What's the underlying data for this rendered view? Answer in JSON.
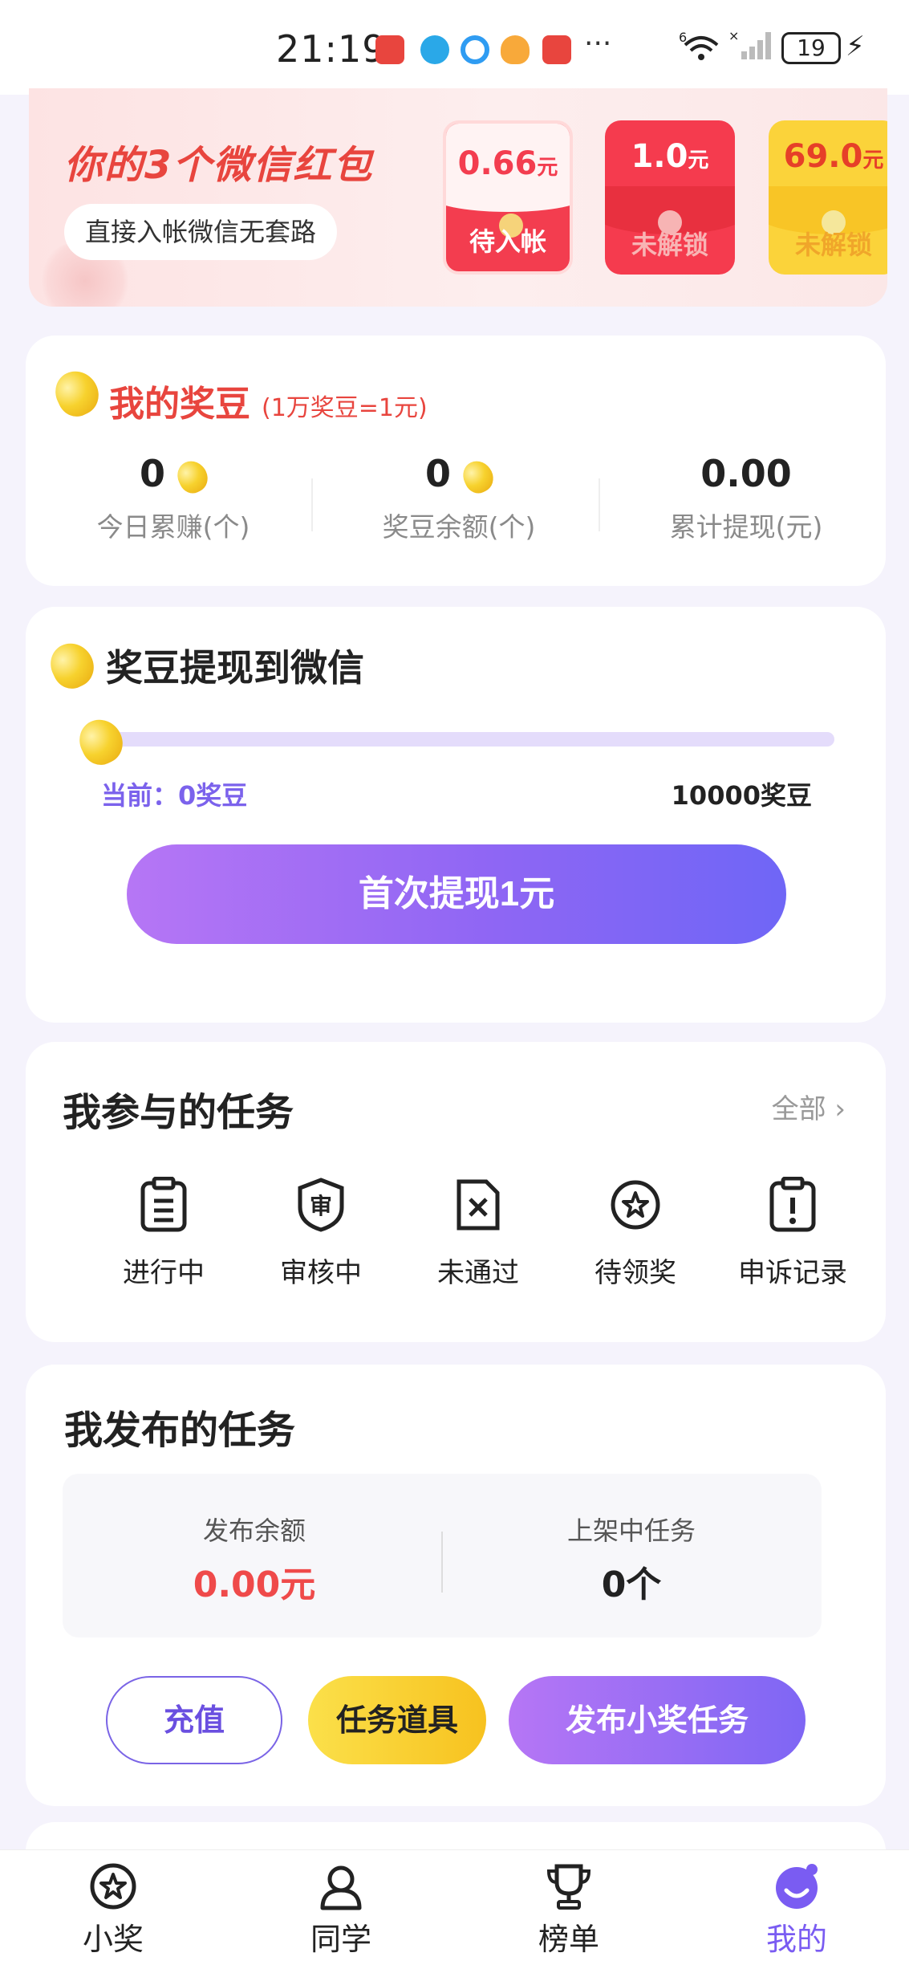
{
  "status_bar": {
    "time": "21:19",
    "more": "···",
    "network": "6",
    "battery": "19",
    "icons": [
      "huawei-store-icon",
      "browser-icon",
      "search-icon",
      "cat-app-icon",
      "huawei-store-icon",
      "wifi-icon",
      "signal-icon",
      "battery-icon",
      "charging-icon"
    ]
  },
  "banner": {
    "title": "你的3个微信红包",
    "subtitle": "直接入帐微信无套路",
    "envelopes": [
      {
        "amount": "0.66",
        "unit": "元",
        "status": "待入帐"
      },
      {
        "amount": "1.0",
        "unit": "元",
        "status": "未解锁"
      },
      {
        "amount": "69.0",
        "unit": "元",
        "status": "未解锁"
      }
    ]
  },
  "beans": {
    "title": "我的奖豆",
    "rate": "(1万奖豆=1元)",
    "stats": [
      {
        "value": "0",
        "label": "今日累赚(个)"
      },
      {
        "value": "0",
        "label": "奖豆余额(个)"
      },
      {
        "value": "0.00",
        "label": "累计提现(元)"
      }
    ]
  },
  "withdraw": {
    "title": "奖豆提现到微信",
    "current": "当前：0奖豆",
    "target": "10000奖豆",
    "progress": 0,
    "button": "首次提现1元"
  },
  "my_tasks": {
    "title": "我参与的任务",
    "all": "全部",
    "items": [
      {
        "label": "进行中",
        "icon": "clipboard-icon"
      },
      {
        "label": "审核中",
        "icon": "shield-review-icon"
      },
      {
        "label": "未通过",
        "icon": "rejected-file-icon"
      },
      {
        "label": "待领奖",
        "icon": "star-badge-icon"
      },
      {
        "label": "申诉记录",
        "icon": "appeal-clipboard-icon"
      }
    ]
  },
  "publish": {
    "title": "我发布的任务",
    "balance_label": "发布余额",
    "balance_value": "0.00元",
    "listed_label": "上架中任务",
    "listed_value": "0个",
    "buttons": {
      "recharge": "充值",
      "props": "任务道具",
      "publish": "发布小奖任务"
    }
  },
  "nav": {
    "items": [
      {
        "label": "小奖",
        "icon": "star-circle-icon"
      },
      {
        "label": "同学",
        "icon": "classmate-icon"
      },
      {
        "label": "榜单",
        "icon": "trophy-icon"
      },
      {
        "label": "我的",
        "icon": "profile-smile-icon"
      }
    ],
    "active": "我的"
  },
  "colors": {
    "accent": "#7a5cf2",
    "red": "#e8453e",
    "bean": "#f7d22e"
  }
}
